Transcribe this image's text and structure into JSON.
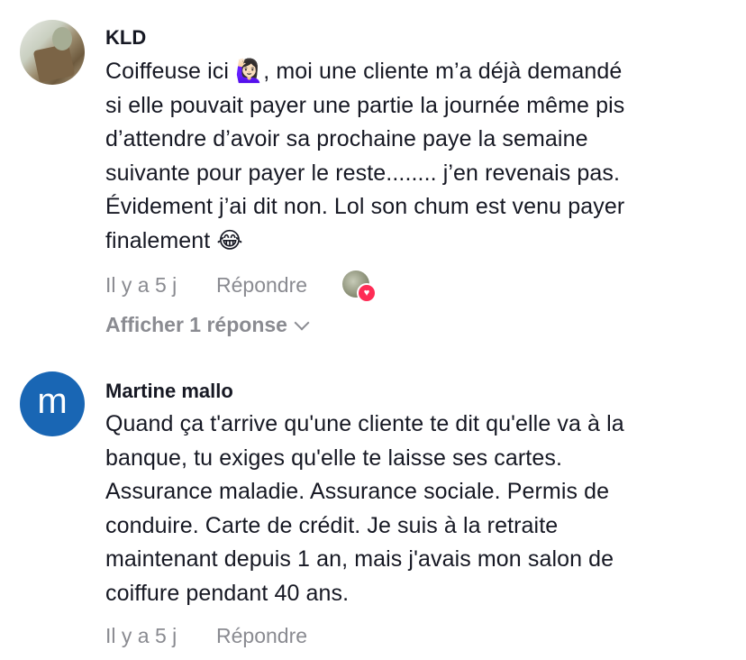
{
  "comments": [
    {
      "username": "KLD",
      "text_lines": [
        "Coiffeuse ici 🙋🏻‍♀️, moi une cliente m’a déjà demandé",
        "si elle pouvait payer une partie la journée même pis",
        "d’attendre d’avoir sa prochaine paye la semaine",
        "suivante pour payer le reste........ j’en revenais pas.",
        "Évidement j’ai dit non. Lol son chum est venu payer",
        "finalement 😂"
      ],
      "time": "Il y a 5 j",
      "reply_label": "Répondre",
      "show_replies_label": "Afficher 1 réponse",
      "avatar_icon": "profile-photo"
    },
    {
      "username": "Martine mallo",
      "avatar_letter": "m",
      "avatar_color": "#1966b4",
      "text_lines": [
        "Quand ça t'arrive qu'une cliente te dit qu'elle va à la",
        "banque, tu exiges qu'elle te laisse ses cartes.",
        "Assurance maladie. Assurance sociale. Permis de",
        "conduire. Carte de crédit. Je suis à la retraite",
        "maintenant depuis 1 an, mais j'avais mon salon de",
        "coiffure pendant 40 ans."
      ],
      "time": "Il y a 5 j",
      "reply_label": "Répondre"
    }
  ],
  "colors": {
    "text": "#161823",
    "muted": "#8a8b91",
    "heart_badge": "#fe2c55"
  }
}
